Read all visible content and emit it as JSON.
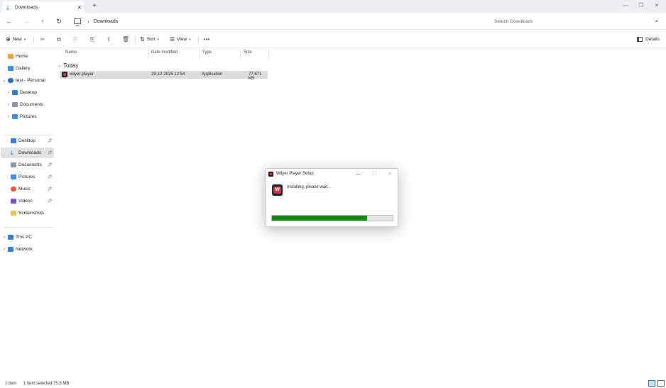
{
  "window": {
    "tab_title": "Downloads",
    "tab_close": "✕",
    "new_tab": "+",
    "minimize": "—",
    "restore": "❐",
    "close": "✕"
  },
  "address": {
    "breadcrumb": "Downloads",
    "search_placeholder": "Search Downloads"
  },
  "toolbar": {
    "new_label": "New",
    "sort_label": "Sort",
    "view_label": "View",
    "details_label": "Details"
  },
  "sidebar": {
    "quick": [
      {
        "label": "Home",
        "icon": "home-icon"
      },
      {
        "label": "Gallery",
        "icon": "gallery-icon"
      },
      {
        "label": "test - Personal",
        "icon": "onedrive-icon"
      },
      {
        "label": "Desktop",
        "icon": "desktop-icon"
      },
      {
        "label": "Documents",
        "icon": "documents-icon"
      },
      {
        "label": "Pictures",
        "icon": "pictures-icon"
      }
    ],
    "pinned": [
      {
        "label": "Desktop",
        "icon": "desktop-icon"
      },
      {
        "label": "Downloads",
        "icon": "download-icon"
      },
      {
        "label": "Documents",
        "icon": "documents-icon"
      },
      {
        "label": "Pictures",
        "icon": "pictures-icon"
      },
      {
        "label": "Music",
        "icon": "music-icon"
      },
      {
        "label": "Videos",
        "icon": "videos-icon"
      },
      {
        "label": "Screenshots",
        "icon": "folder-icon"
      }
    ],
    "system": [
      {
        "label": "This PC",
        "icon": "pc-icon"
      },
      {
        "label": "Network",
        "icon": "network-icon"
      }
    ]
  },
  "file_list": {
    "columns": [
      "Name",
      "Date modified",
      "Type",
      "Size"
    ],
    "group": "Today",
    "rows": [
      {
        "name": "wilyer-player",
        "date": "29-12-2025 12:54",
        "type": "Application",
        "size": "77,671 KB"
      }
    ]
  },
  "status": {
    "count": "1 item",
    "selected": "1 item selected  75.8 MB"
  },
  "dialog": {
    "title": "Wilyer Player Setup",
    "message": "Installing, please wait...",
    "logo_letter": "W",
    "progress": 0.79
  },
  "colors": {
    "progress_fill": "#0e8a0e",
    "accent": "#1a73c7",
    "selection": "#dcdcdc"
  }
}
